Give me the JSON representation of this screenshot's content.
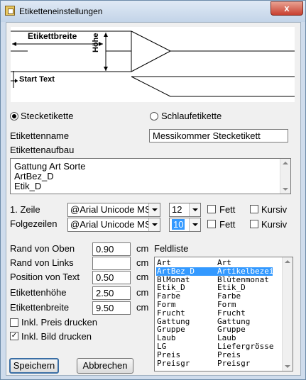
{
  "window": {
    "title": "Etiketteneinstellungen",
    "close_label": "x"
  },
  "preview": {
    "width_label": "Etikettbreite",
    "height_label": "Höhe",
    "start_text_label": "Start Text"
  },
  "type": {
    "option1": "Stecketikette",
    "option2": "Schlaufetikette",
    "selected": "Stecketikette"
  },
  "name": {
    "label": "Etikettenname",
    "value": "Messikommer Stecketikett"
  },
  "structure": {
    "label": "Etikettenaufbau",
    "lines": [
      "Gattung Art Sorte",
      "ArtBez_D",
      "Etik_D"
    ]
  },
  "line1": {
    "label": "1. Zeile",
    "font": "@Arial Unicode MS",
    "size": "12",
    "bold_label": "Fett",
    "italic_label": "Kursiv"
  },
  "next_lines": {
    "label": "Folgezeilen",
    "font": "@Arial Unicode MS",
    "size": "10",
    "bold_label": "Fett",
    "italic_label": "Kursiv"
  },
  "dimensions": {
    "unit": "cm",
    "rows": [
      {
        "label": "Rand von Oben",
        "value": "0.90"
      },
      {
        "label": "Rand von Links",
        "value": ""
      },
      {
        "label": "Position von Text",
        "value": "0.50"
      },
      {
        "label": "Etikettenhöhe",
        "value": "2.50"
      },
      {
        "label": "Etikettenbreite",
        "value": "9.50"
      }
    ]
  },
  "options": {
    "price_label": "Inkl. Preis drucken",
    "price_checked": false,
    "image_label": "Inkl. Bild drucken",
    "image_checked": true
  },
  "fieldlist": {
    "label": "Feldliste",
    "rows": [
      [
        "Art",
        "Art"
      ],
      [
        "ArtBez_D",
        "Artikelbezei"
      ],
      [
        "BlMonat",
        "Blütenmonat"
      ],
      [
        "Etik_D",
        "Etik_D"
      ],
      [
        "Farbe",
        "Farbe"
      ],
      [
        "Form",
        "Form"
      ],
      [
        "Frucht",
        "Frucht"
      ],
      [
        "Gattung",
        "Gattung"
      ],
      [
        "Gruppe",
        "Gruppe"
      ],
      [
        "Laub",
        "Laub"
      ],
      [
        "LG",
        "Liefergrösse"
      ],
      [
        "Preis",
        "Preis"
      ],
      [
        "Preisgr",
        "Preisgr"
      ]
    ],
    "selected_index": 1
  },
  "buttons": {
    "save": "Speichern",
    "cancel": "Abbrechen"
  }
}
